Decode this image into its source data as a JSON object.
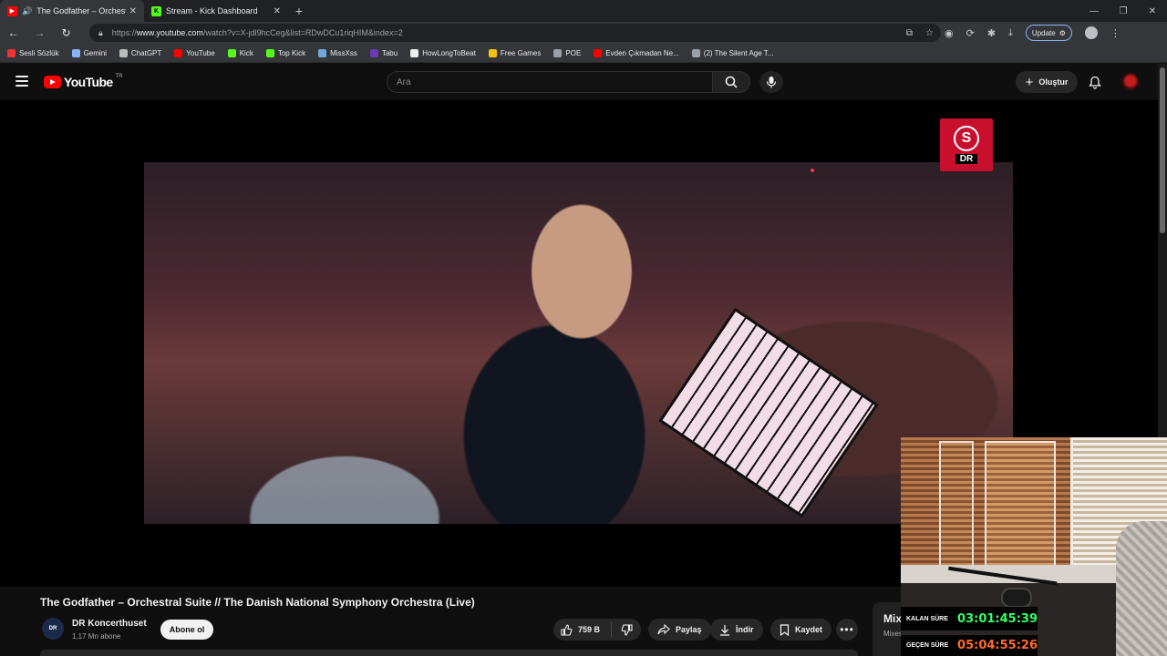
{
  "browser": {
    "tabs": [
      {
        "title": "The Godfather – Orchestral Suite",
        "favicon": "youtube-icon",
        "active": true,
        "audio": true
      },
      {
        "title": "Stream - Kick Dashboard",
        "favicon": "kick-icon",
        "active": false,
        "audio": false
      }
    ],
    "url_prefix": "https://",
    "url_host": "www.youtube.com",
    "url_path": "/watch?v=X-jdl9hcCeg&list=RDwDCu1riqHIM&index=2",
    "update_label": "Update",
    "bookmarks": [
      {
        "label": "Sesli Sözlük",
        "icon": "sesli-sozluk-icon",
        "color": "#e33"
      },
      {
        "label": "Gemini",
        "icon": "gemini-icon",
        "color": "#8ab4f8"
      },
      {
        "label": "ChatGPT",
        "icon": "chatgpt-icon",
        "color": "#bbbbbb"
      },
      {
        "label": "YouTube",
        "icon": "youtube-icon",
        "color": "#ff0000"
      },
      {
        "label": "Kick",
        "icon": "kick-icon",
        "color": "#53fc18"
      },
      {
        "label": "Top Kick",
        "icon": "kick-icon",
        "color": "#53fc18"
      },
      {
        "label": "MissXss",
        "icon": "missxss-icon",
        "color": "#6fa8dc"
      },
      {
        "label": "Tabu",
        "icon": "tabu-icon",
        "color": "#673ab7"
      },
      {
        "label": "HowLongToBeat",
        "icon": "hltb-icon",
        "color": "#eeeeee"
      },
      {
        "label": "Free Games",
        "icon": "free-games-icon",
        "color": "#f4c20d"
      },
      {
        "label": "POE",
        "icon": "folder-icon",
        "color": "#9aa0a6"
      },
      {
        "label": "Evden Çıkmadan Ne...",
        "icon": "youtube-icon",
        "color": "#ff0000"
      },
      {
        "label": "(2) The Silent Age T...",
        "icon": "globe-icon",
        "color": "#9aa0a6"
      }
    ]
  },
  "youtube": {
    "logo_text": "YouTube",
    "country_code": "TR",
    "search_placeholder": "Ara",
    "create_label": "Oluştur",
    "video_title": "The Godfather – Orchestral Suite // The Danish National Symphony Orchestra (Live)",
    "channel_name": "DR Koncerthuset",
    "channel_subs": "1,17 Mn abone",
    "channel_avatar_text": "DR",
    "subscribe_label": "Abone ol",
    "like_count": "759 B",
    "share_label": "Paylaş",
    "download_label": "İndir",
    "save_label": "Kaydet",
    "mix_title": "Mix",
    "mix_sub": "Mixes",
    "dr_logo_letter": "S",
    "dr_logo_text": "DR"
  },
  "overlay": {
    "remaining_label": "KALAN SÜRE",
    "remaining_value": "03:01:45:39",
    "elapsed_label": "GEÇEN SÜRE",
    "elapsed_value": "05:04:55:26"
  }
}
